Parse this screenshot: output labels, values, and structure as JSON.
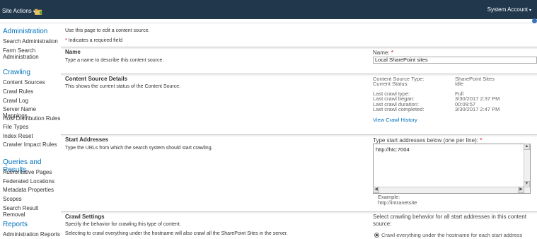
{
  "topbar": {
    "site_actions": "Site Actions",
    "account": "System Account"
  },
  "sidebar": {
    "administration": {
      "heading": "Administration",
      "items": [
        "Search Administration",
        "Farm Search Administration"
      ]
    },
    "crawling": {
      "heading": "Crawling",
      "items": [
        "Content Sources",
        "Crawl Rules",
        "Crawl Log",
        "Server Name Mappings",
        "Host Distribution Rules",
        "File Types",
        "Index Reset",
        "Crawler Impact Rules"
      ]
    },
    "queries": {
      "heading": "Queries and Results",
      "items": [
        "Authoritative Pages",
        "Federated Locations",
        "Metadata Properties",
        "Scopes",
        "Search Result Removal"
      ]
    },
    "reports": {
      "heading": "Reports",
      "items": [
        "Administration Reports"
      ]
    }
  },
  "intro": {
    "line1": "Use this page to edit a content source.",
    "star": "*",
    "line2": "Indicates a required field"
  },
  "name_section": {
    "title": "Name",
    "desc": "Type a name to describe this content source.",
    "field_label": "Name:",
    "star": "*",
    "value": "Local SharePoint sites"
  },
  "details_section": {
    "title": "Content Source Details",
    "desc": "This shows the current status of the Content Source.",
    "rows": [
      {
        "k": "Content Source Type:",
        "v": "SharePoint Sites"
      },
      {
        "k": "Current Status:",
        "v": "Idle"
      }
    ],
    "rows2": [
      {
        "k": "Last crawl type:",
        "v": "Full"
      },
      {
        "k": "Last crawl began:",
        "v": "3/30/2017 2:37 PM"
      },
      {
        "k": "Last crawl duration:",
        "v": "00:09:57"
      },
      {
        "k": "Last crawl completed:",
        "v": "3/30/2017 2:47 PM"
      }
    ],
    "history_link": "View Crawl History"
  },
  "start_section": {
    "title": "Start Addresses",
    "desc": "Type the URLs from which the search system should start crawling.",
    "field_label": "Type start addresses below (one per line):",
    "star": "*",
    "value": "http://htc:7004",
    "example_label": "Example:",
    "example_value": "http://intranetsite"
  },
  "crawl_section": {
    "title": "Crawl Settings",
    "desc1": "Specify the behavior for crawling this type of content.",
    "desc2": "Selecting to crawl everything under the hostname will also crawl all the SharePoint Sites in the server.",
    "right_text": "Select crawling behavior for all start addresses in this content source:",
    "radio_label": "Crawl everything under the hostname for each start address"
  },
  "colors": {
    "topbar": "#21374c",
    "accent": "#0072bc",
    "required": "#cc0000"
  }
}
